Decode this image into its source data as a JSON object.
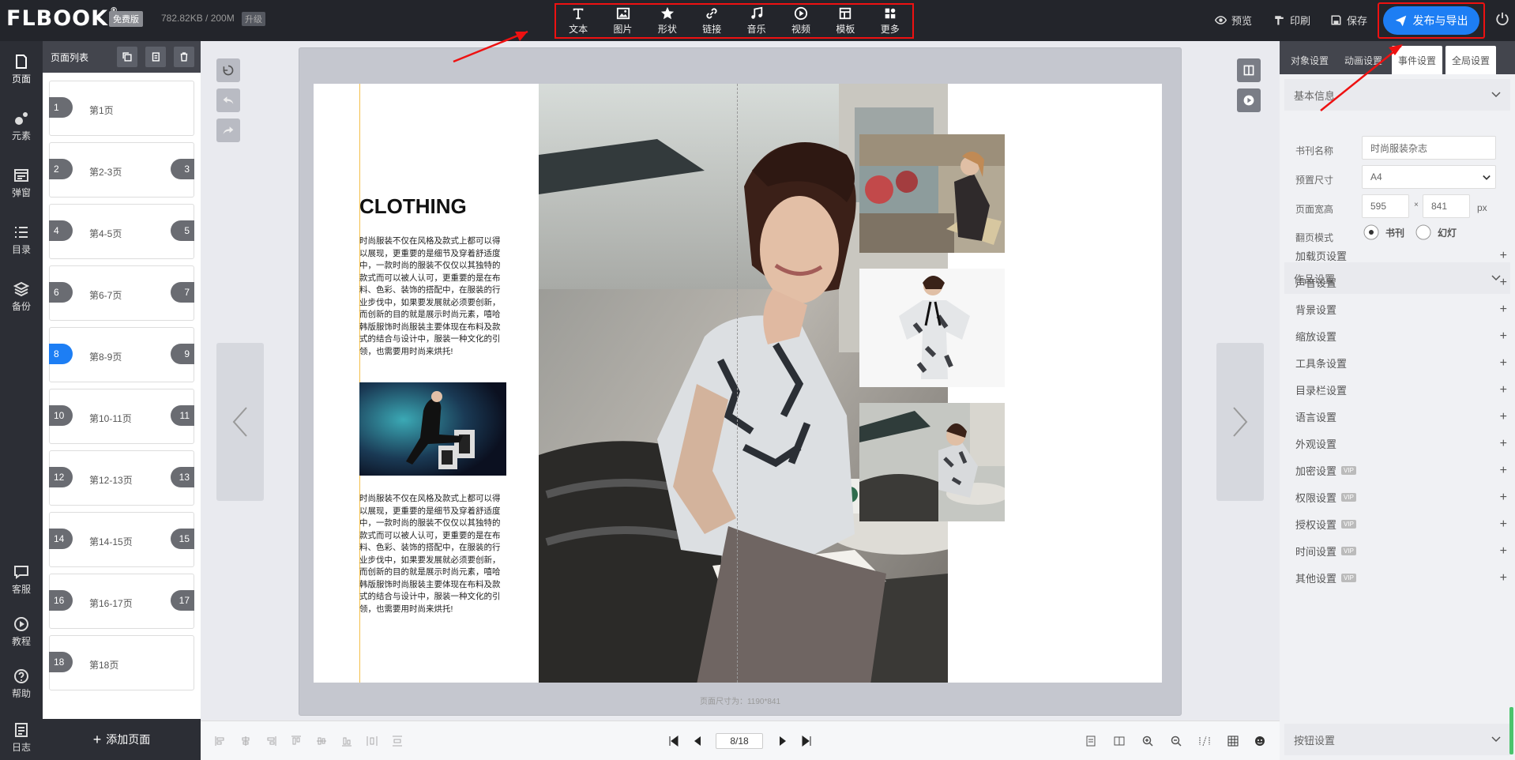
{
  "topbar": {
    "logo": "FLBOOK",
    "logo_mark": "®",
    "plan_badge": "免费版",
    "storage": "782.82KB / 200M",
    "upgrade": "升级",
    "tools": [
      {
        "label": "文本",
        "icon": "text-icon"
      },
      {
        "label": "图片",
        "icon": "image-icon"
      },
      {
        "label": "形状",
        "icon": "star-icon"
      },
      {
        "label": "链接",
        "icon": "link-icon"
      },
      {
        "label": "音乐",
        "icon": "music-icon"
      },
      {
        "label": "视频",
        "icon": "play-circle-icon"
      },
      {
        "label": "模板",
        "icon": "template-icon"
      },
      {
        "label": "更多",
        "icon": "more-icon"
      }
    ],
    "preview": "预览",
    "print": "印刷",
    "save": "保存",
    "publish": "发布与导出"
  },
  "leftnav": {
    "items": [
      {
        "label": "页面",
        "icon": "page-icon"
      },
      {
        "label": "元素",
        "icon": "elements-icon"
      },
      {
        "label": "弹窗",
        "icon": "popup-icon"
      },
      {
        "label": "目录",
        "icon": "list-icon"
      },
      {
        "label": "备份",
        "icon": "layers-icon"
      }
    ],
    "bottom_items": [
      {
        "label": "客服",
        "icon": "chat-icon"
      },
      {
        "label": "教程",
        "icon": "play-icon"
      },
      {
        "label": "帮助",
        "icon": "help-icon"
      },
      {
        "label": "日志",
        "icon": "log-icon"
      }
    ]
  },
  "pagepanel": {
    "title": "页面列表",
    "pages": [
      {
        "left": "1",
        "label": "第1页",
        "right": ""
      },
      {
        "left": "2",
        "label": "第2-3页",
        "right": "3"
      },
      {
        "left": "4",
        "label": "第4-5页",
        "right": "5"
      },
      {
        "left": "6",
        "label": "第6-7页",
        "right": "7"
      },
      {
        "left": "8",
        "label": "第8-9页",
        "right": "9"
      },
      {
        "left": "10",
        "label": "第10-11页",
        "right": "11"
      },
      {
        "left": "12",
        "label": "第12-13页",
        "right": "13"
      },
      {
        "left": "14",
        "label": "第14-15页",
        "right": "15"
      },
      {
        "left": "16",
        "label": "第16-17页",
        "right": "17"
      },
      {
        "left": "18",
        "label": "第18页",
        "right": ""
      }
    ],
    "active_index": 4,
    "add_page": "添加页面"
  },
  "canvas": {
    "magazine_title": "CLOTHING",
    "paragraph": "时尚服装不仅在风格及款式上都可以得以展现，更重要的是细节及穿着舒适度中，一款时尚的服装不仅仅以其独特的款式而可以被人认可，更重要的是在布料、色彩、装饰的搭配中，在服装的行业步伐中，如果要发展就必须要创新，而创新的目的就是展示时尚元素，嘻哈韩版服饰时尚服装主要体现在布料及款式的结合与设计中，服装一种文化的引领，也需要用时尚来烘托!",
    "page_size_caption": "页面尺寸为：1190*841",
    "page_indicator": "8/18"
  },
  "rightpanel": {
    "tabs": [
      "对象设置",
      "动画设置",
      "事件设置",
      "全局设置"
    ],
    "active_tab": 2,
    "basic_info": "基本信息",
    "fields": {
      "name_label": "书刊名称",
      "name_value": "时尚服装杂志",
      "preset_label": "预置尺寸",
      "preset_value": "A4",
      "size_label": "页面宽高",
      "width": "595",
      "height": "841",
      "unit": "px",
      "times": "×",
      "flip_label": "翻页模式",
      "flip_book": "书刊",
      "flip_slide": "幻灯"
    },
    "work_settings": "作品设置",
    "settings": [
      {
        "label": "加载页设置",
        "vip": ""
      },
      {
        "label": "声音设置",
        "vip": ""
      },
      {
        "label": "背景设置",
        "vip": ""
      },
      {
        "label": "缩放设置",
        "vip": ""
      },
      {
        "label": "工具条设置",
        "vip": ""
      },
      {
        "label": "目录栏设置",
        "vip": ""
      },
      {
        "label": "语言设置",
        "vip": ""
      },
      {
        "label": "外观设置",
        "vip": ""
      },
      {
        "label": "加密设置",
        "vip": "VIP"
      },
      {
        "label": "权限设置",
        "vip": "VIP"
      },
      {
        "label": "授权设置",
        "vip": "VIP"
      },
      {
        "label": "时间设置",
        "vip": "VIP"
      },
      {
        "label": "其他设置",
        "vip": "VIP"
      }
    ],
    "button_settings": "按钮设置"
  },
  "colors": {
    "accent": "#1d7ef4",
    "topbar": "#23252b",
    "highlight": "#e11111"
  }
}
